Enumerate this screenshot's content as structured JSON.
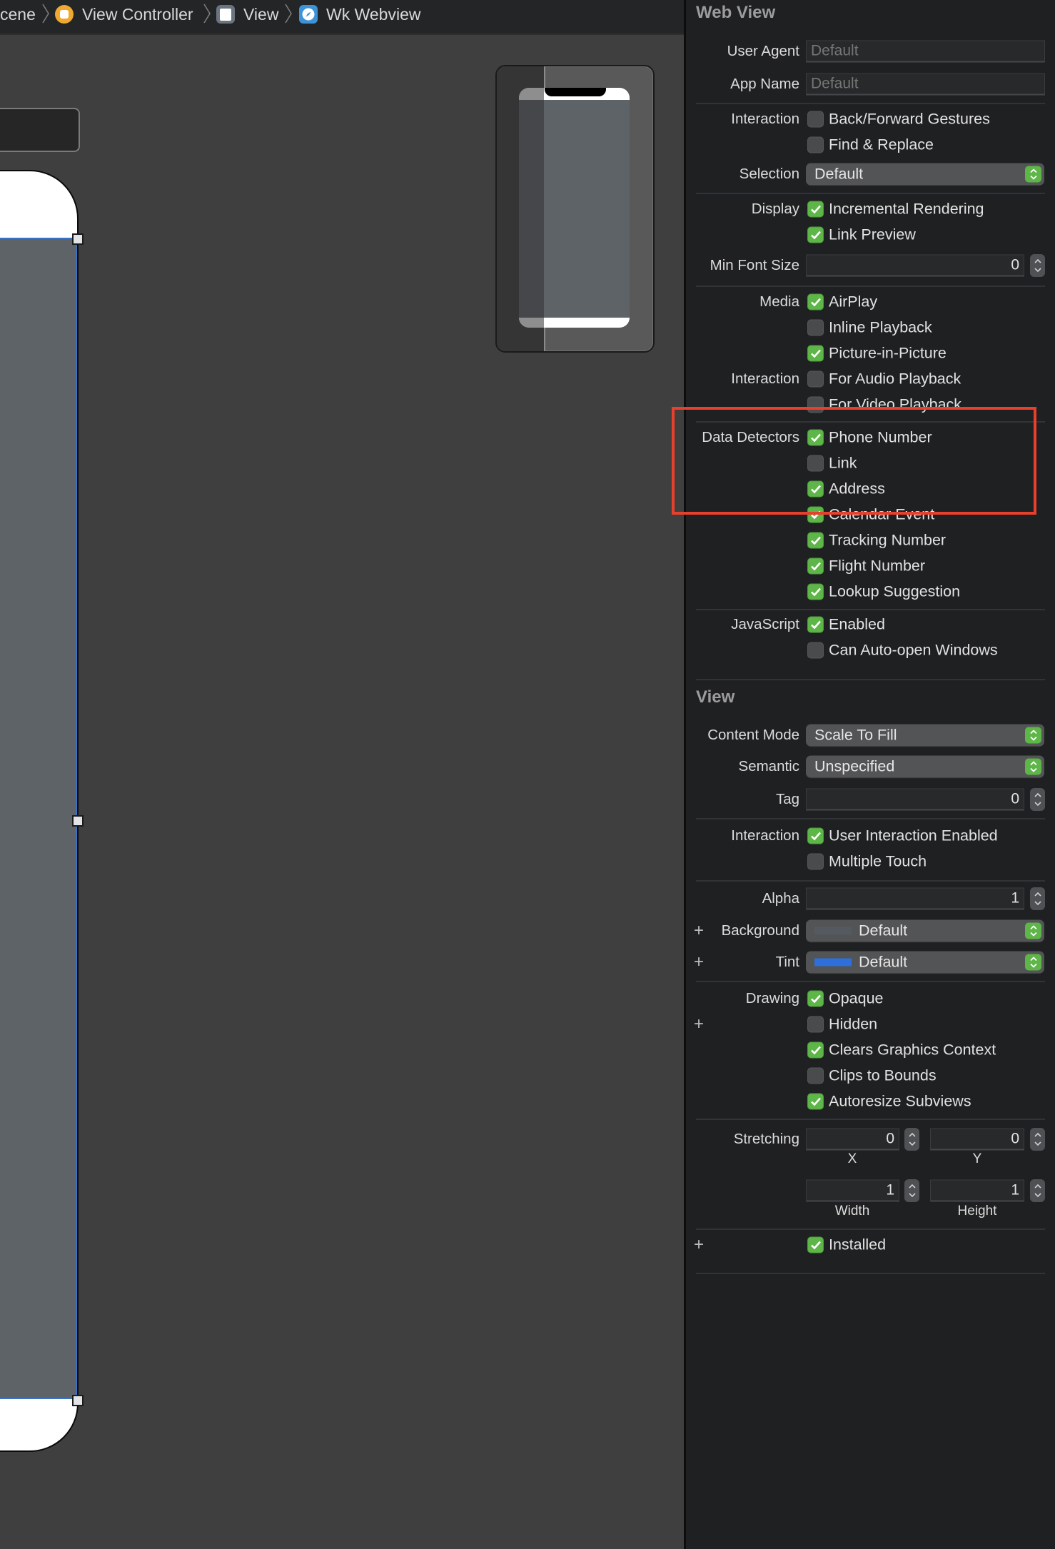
{
  "breadcrumb": {
    "items": [
      {
        "label": "cene",
        "icon": "scene-icon"
      },
      {
        "label": "View Controller",
        "icon": "view-controller-icon",
        "icon_color": "#f0a930"
      },
      {
        "label": "View",
        "icon": "view-icon",
        "icon_color": "#6c7480"
      },
      {
        "label": "Wk Webview",
        "icon": "webview-compass-icon",
        "icon_color": "#3d93d8"
      }
    ]
  },
  "inspector": {
    "web_view": {
      "title": "Web View",
      "user_agent": {
        "label": "User Agent",
        "placeholder": "Default",
        "value": ""
      },
      "app_name": {
        "label": "App Name",
        "placeholder": "Default",
        "value": ""
      },
      "interaction": {
        "label": "Interaction",
        "options": [
          {
            "label": "Back/Forward Gestures",
            "checked": false
          },
          {
            "label": "Find & Replace",
            "checked": false
          }
        ]
      },
      "selection": {
        "label": "Selection",
        "value": "Default"
      },
      "display": {
        "label": "Display",
        "options": [
          {
            "label": "Incremental Rendering",
            "checked": true
          },
          {
            "label": "Link Preview",
            "checked": true
          }
        ]
      },
      "min_font_size": {
        "label": "Min Font Size",
        "value": "0"
      },
      "media": {
        "label": "Media",
        "options": [
          {
            "label": "AirPlay",
            "checked": true
          },
          {
            "label": "Inline Playback",
            "checked": false
          },
          {
            "label": "Picture-in-Picture",
            "checked": true
          }
        ]
      },
      "media_interaction": {
        "label": "Interaction",
        "options": [
          {
            "label": "For Audio Playback",
            "checked": false
          },
          {
            "label": "For Video Playback",
            "checked": false
          }
        ]
      },
      "data_detectors": {
        "label": "Data Detectors",
        "options": [
          {
            "label": "Phone Number",
            "checked": true
          },
          {
            "label": "Link",
            "checked": false
          },
          {
            "label": "Address",
            "checked": true
          },
          {
            "label": "Calendar Event",
            "checked": true
          },
          {
            "label": "Tracking Number",
            "checked": true
          },
          {
            "label": "Flight Number",
            "checked": true
          },
          {
            "label": "Lookup Suggestion",
            "checked": true
          }
        ]
      },
      "javascript": {
        "label": "JavaScript",
        "options": [
          {
            "label": "Enabled",
            "checked": true
          },
          {
            "label": "Can Auto-open Windows",
            "checked": false
          }
        ]
      }
    },
    "view": {
      "title": "View",
      "content_mode": {
        "label": "Content Mode",
        "value": "Scale To Fill"
      },
      "semantic": {
        "label": "Semantic",
        "value": "Unspecified"
      },
      "tag": {
        "label": "Tag",
        "value": "0"
      },
      "interaction": {
        "label": "Interaction",
        "options": [
          {
            "label": "User Interaction Enabled",
            "checked": true
          },
          {
            "label": "Multiple Touch",
            "checked": false
          }
        ]
      },
      "alpha": {
        "label": "Alpha",
        "value": "1"
      },
      "background": {
        "label": "Background",
        "value": "Default",
        "swatch_color": "#555a60"
      },
      "tint": {
        "label": "Tint",
        "value": "Default",
        "swatch_color": "#2f6fdb"
      },
      "drawing": {
        "label": "Drawing",
        "options": [
          {
            "label": "Opaque",
            "checked": true
          },
          {
            "label": "Hidden",
            "checked": false
          },
          {
            "label": "Clears Graphics Context",
            "checked": true
          },
          {
            "label": "Clips to Bounds",
            "checked": false
          },
          {
            "label": "Autoresize Subviews",
            "checked": true
          }
        ]
      },
      "stretching": {
        "label": "Stretching",
        "x": {
          "label": "X",
          "value": "0"
        },
        "y": {
          "label": "Y",
          "value": "0"
        },
        "width": {
          "label": "Width",
          "value": "1"
        },
        "height": {
          "label": "Height",
          "value": "1"
        }
      },
      "installed": {
        "label": "Installed",
        "checked": true
      }
    }
  },
  "annotation": {
    "highlight_color": "#e8402c",
    "target": "Data Detectors"
  },
  "colors": {
    "accent_green": "#5eb548",
    "selection_blue": "#3b73c4"
  }
}
